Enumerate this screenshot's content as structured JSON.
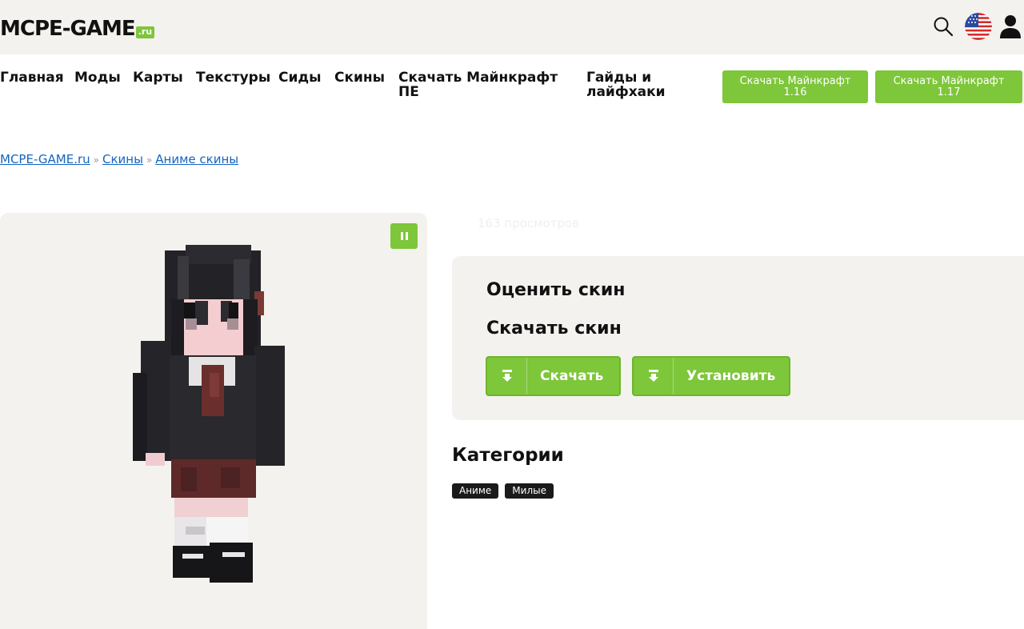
{
  "header": {
    "logo_text": "MCPE-GAME",
    "logo_suffix": ".ru"
  },
  "nav": {
    "items": [
      {
        "label": "Главная"
      },
      {
        "label": "Моды"
      },
      {
        "label": "Карты"
      },
      {
        "label": "Текстуры"
      },
      {
        "label": "Сиды"
      },
      {
        "label": "Скины"
      },
      {
        "label": "Скачать Майнкрафт ПЕ"
      },
      {
        "label": "Гайды и лайфхаки"
      }
    ],
    "download_buttons": [
      {
        "line1": "Скачать Майнкрафт",
        "line2": "1.16"
      },
      {
        "line1": "Скачать Майнкрафт",
        "line2": "1.17"
      }
    ]
  },
  "breadcrumb": {
    "items": [
      "MCPE-GAME.ru",
      "Скины",
      "Аниме скины"
    ],
    "separator": "»"
  },
  "skin": {
    "views": "163 просмотров",
    "rate_title": "Оценить скин",
    "download_title": "Скачать скин",
    "download_button": "Скачать",
    "install_button": "Установить"
  },
  "categories": {
    "title": "Категории",
    "tags": [
      "Аниме",
      "Милые"
    ]
  },
  "colors": {
    "accent": "#7ec63a",
    "panel": "#f4f2ee",
    "link": "#1565c0"
  }
}
